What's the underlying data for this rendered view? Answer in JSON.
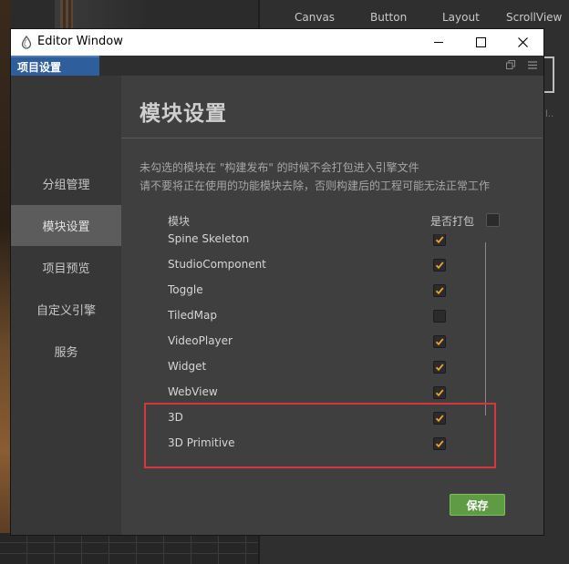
{
  "background": {
    "tabs": [
      "Canvas",
      "Button",
      "Layout",
      "ScrollView"
    ]
  },
  "window": {
    "title": "Editor Window",
    "tab": "项目设置"
  },
  "sidebar": {
    "items": [
      {
        "label": "分组管理",
        "active": false
      },
      {
        "label": "模块设置",
        "active": true
      },
      {
        "label": "项目预览",
        "active": false
      },
      {
        "label": "自定义引擎",
        "active": false
      },
      {
        "label": "服务",
        "active": false
      }
    ]
  },
  "main": {
    "title": "模块设置",
    "desc_line1": "未勾选的模块在 \"构建发布\" 的时候不会打包进入引擎文件",
    "desc_line2": "请不要将正在使用的功能模块去除，否则构建后的工程可能无法正常工作",
    "col_module": "模块",
    "col_include": "是否打包",
    "modules": [
      {
        "name": "Spine Skeleton",
        "checked": true
      },
      {
        "name": "StudioComponent",
        "checked": true
      },
      {
        "name": "Toggle",
        "checked": true
      },
      {
        "name": "TiledMap",
        "checked": false
      },
      {
        "name": "VideoPlayer",
        "checked": true
      },
      {
        "name": "Widget",
        "checked": true
      },
      {
        "name": "WebView",
        "checked": true
      },
      {
        "name": "3D",
        "checked": true
      },
      {
        "name": "3D Primitive",
        "checked": true
      }
    ],
    "save_label": "保存"
  },
  "colors": {
    "accent_tab": "#2f5e9c",
    "save_button": "#5f9a45",
    "checkmark": "#f0a030",
    "highlight_box": "#d7373b"
  }
}
